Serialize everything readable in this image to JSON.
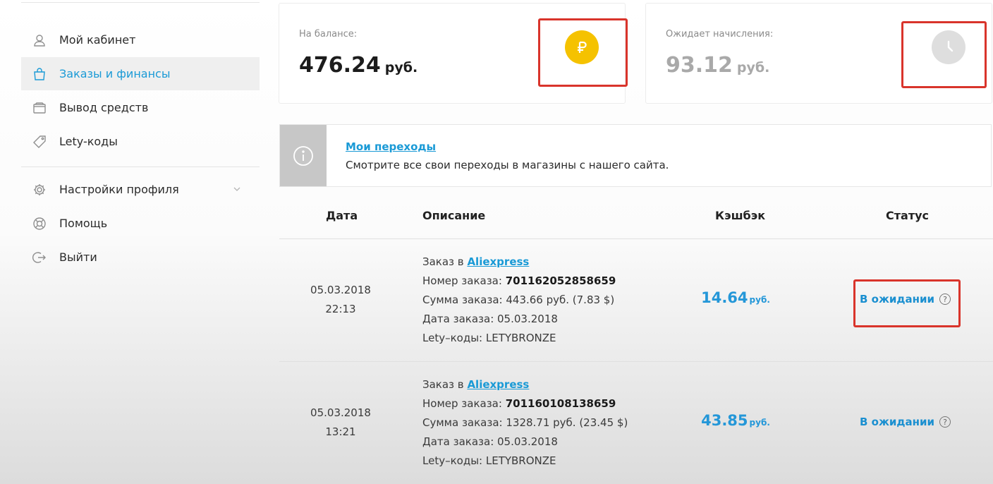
{
  "sidebar": {
    "items": [
      {
        "label": "Мой кабинет",
        "icon": "user-icon"
      },
      {
        "label": "Заказы и финансы",
        "icon": "shopping-bag-icon"
      },
      {
        "label": "Вывод средств",
        "icon": "wallet-icon"
      },
      {
        "label": "Lety-коды",
        "icon": "tag-icon"
      },
      {
        "label": "Настройки профиля",
        "icon": "gear-icon"
      },
      {
        "label": "Помощь",
        "icon": "lifebuoy-icon"
      },
      {
        "label": "Выйти",
        "icon": "logout-icon"
      }
    ],
    "active_index": 1
  },
  "balance": {
    "label": "На балансе:",
    "amount": "476.24",
    "currency": "руб.",
    "icon": "ruble-coin-icon",
    "icon_color": "#f5c200"
  },
  "pending": {
    "label": "Ожидает начисления:",
    "amount": "93.12",
    "currency": "руб.",
    "icon": "clock-icon",
    "icon_color": "#dedede"
  },
  "banner": {
    "title": "Мои переходы",
    "text": "Смотрите все свои переходы в магазины с нашего сайта."
  },
  "table": {
    "headers": {
      "date": "Дата",
      "description": "Описание",
      "cashback": "Кэшбэк",
      "status": "Статус"
    },
    "rows": [
      {
        "date": "05.03.2018",
        "time": "22:13",
        "order_prefix": "Заказ в",
        "store": "Aliexpress",
        "order_number_label": "Номер заказа:",
        "order_number": "701162052858659",
        "sum_line": "Сумма заказа: 443.66 руб. (7.83 $)",
        "date_line": "Дата заказа: 05.03.2018",
        "codes_line": "Lety–коды: LETYBRONZE",
        "cashback": "14.64",
        "cashback_currency": "руб.",
        "status": "В ожидании"
      },
      {
        "date": "05.03.2018",
        "time": "13:21",
        "order_prefix": "Заказ в",
        "store": "Aliexpress",
        "order_number_label": "Номер заказа:",
        "order_number": "701160108138659",
        "sum_line": "Сумма заказа: 1328.71 руб. (23.45 $)",
        "date_line": "Дата заказа: 05.03.2018",
        "codes_line": "Lety–коды: LETYBRONZE",
        "cashback": "43.85",
        "cashback_currency": "руб.",
        "status": "В ожидании"
      }
    ]
  },
  "colors": {
    "accent": "#1a9ad6",
    "highlight": "#d9342b"
  }
}
